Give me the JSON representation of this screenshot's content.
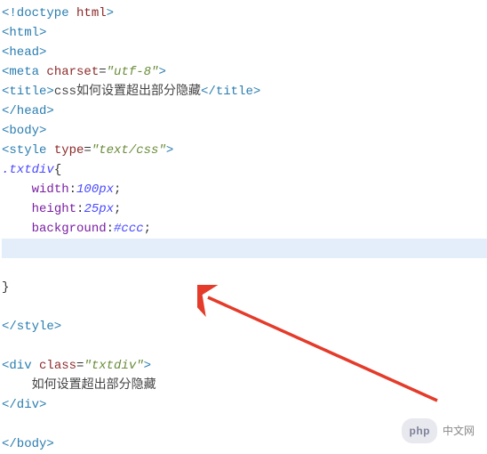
{
  "lines": [
    {
      "segments": [
        {
          "kind": "tag",
          "t": "<!doctype "
        },
        {
          "kind": "attr",
          "t": "html"
        },
        {
          "kind": "tag",
          "t": ">"
        }
      ]
    },
    {
      "segments": [
        {
          "kind": "tag",
          "t": "<html>"
        }
      ]
    },
    {
      "segments": [
        {
          "kind": "tag",
          "t": "<head>"
        }
      ]
    },
    {
      "segments": [
        {
          "kind": "tag",
          "t": "<meta "
        },
        {
          "kind": "attr",
          "t": "charset"
        },
        {
          "kind": "punct",
          "t": "="
        },
        {
          "kind": "val",
          "t": "\"utf-8\""
        },
        {
          "kind": "tag",
          "t": ">"
        }
      ]
    },
    {
      "segments": [
        {
          "kind": "tag",
          "t": "<title>"
        },
        {
          "kind": "txt",
          "t": "css如何设置超出部分隐藏"
        },
        {
          "kind": "tag",
          "t": "</title>"
        }
      ]
    },
    {
      "segments": [
        {
          "kind": "tag",
          "t": "</head>"
        }
      ]
    },
    {
      "segments": [
        {
          "kind": "tag",
          "t": "<body>"
        }
      ]
    },
    {
      "segments": [
        {
          "kind": "tag",
          "t": "<style "
        },
        {
          "kind": "attr",
          "t": "type"
        },
        {
          "kind": "punct",
          "t": "="
        },
        {
          "kind": "val",
          "t": "\"text/css\""
        },
        {
          "kind": "tag",
          "t": ">"
        }
      ]
    },
    {
      "segments": [
        {
          "kind": "sel",
          "t": ".txtdiv"
        },
        {
          "kind": "punct",
          "t": "{"
        }
      ]
    },
    {
      "segments": [
        {
          "kind": "txt",
          "t": "    "
        },
        {
          "kind": "prop",
          "t": "width"
        },
        {
          "kind": "punct",
          "t": ":"
        },
        {
          "kind": "num",
          "t": "100px"
        },
        {
          "kind": "punct",
          "t": ";"
        }
      ]
    },
    {
      "segments": [
        {
          "kind": "txt",
          "t": "    "
        },
        {
          "kind": "prop",
          "t": "height"
        },
        {
          "kind": "punct",
          "t": ":"
        },
        {
          "kind": "num",
          "t": "25px"
        },
        {
          "kind": "punct",
          "t": ";"
        }
      ]
    },
    {
      "segments": [
        {
          "kind": "txt",
          "t": "    "
        },
        {
          "kind": "prop",
          "t": "background"
        },
        {
          "kind": "punct",
          "t": ":"
        },
        {
          "kind": "hex",
          "t": "#ccc"
        },
        {
          "kind": "punct",
          "t": ";"
        }
      ]
    },
    {
      "highlight": true,
      "segments": [
        {
          "kind": "txt",
          "t": " "
        }
      ]
    },
    {
      "segments": [
        {
          "kind": "txt",
          "t": " "
        }
      ]
    },
    {
      "segments": [
        {
          "kind": "punct",
          "t": "}"
        }
      ]
    },
    {
      "segments": [
        {
          "kind": "txt",
          "t": " "
        }
      ]
    },
    {
      "segments": [
        {
          "kind": "tag",
          "t": "</style>"
        }
      ]
    },
    {
      "segments": [
        {
          "kind": "txt",
          "t": " "
        }
      ]
    },
    {
      "segments": [
        {
          "kind": "tag",
          "t": "<div "
        },
        {
          "kind": "attr",
          "t": "class"
        },
        {
          "kind": "punct",
          "t": "="
        },
        {
          "kind": "val",
          "t": "\"txtdiv\""
        },
        {
          "kind": "tag",
          "t": ">"
        }
      ]
    },
    {
      "segments": [
        {
          "kind": "txt",
          "t": "    如何设置超出部分隐藏"
        }
      ]
    },
    {
      "segments": [
        {
          "kind": "tag",
          "t": "</div>"
        }
      ]
    },
    {
      "segments": [
        {
          "kind": "txt",
          "t": " "
        }
      ]
    },
    {
      "segments": [
        {
          "kind": "tag",
          "t": "</body>"
        }
      ]
    }
  ],
  "badge": {
    "pill": "php",
    "text": "中文网"
  }
}
